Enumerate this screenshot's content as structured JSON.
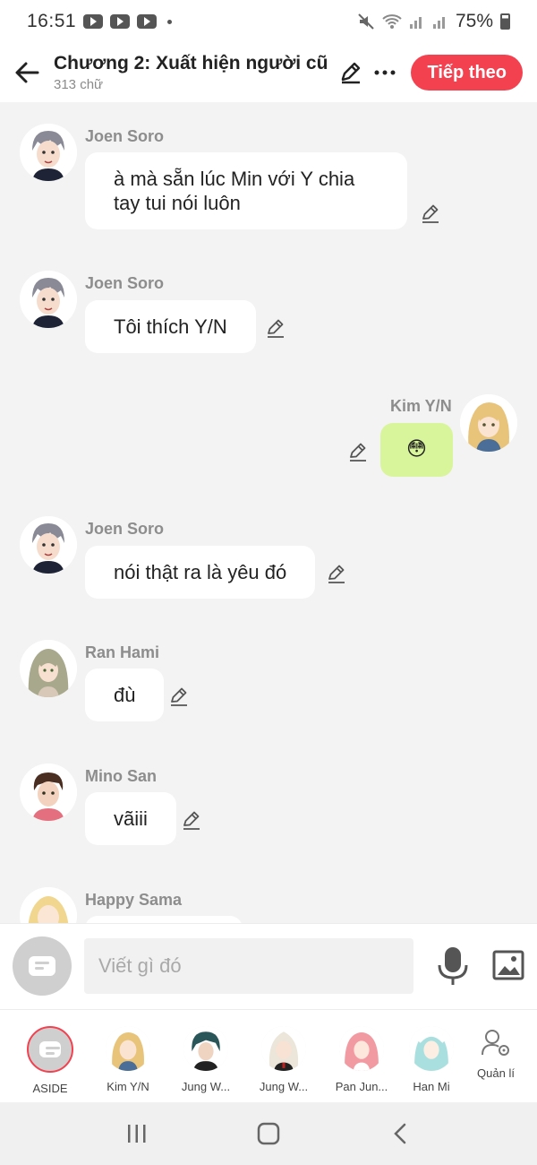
{
  "status": {
    "time": "16:51",
    "battery": "75%",
    "icons": [
      "youtube-icon",
      "youtube-icon",
      "youtube-icon",
      "mute-icon",
      "wifi-icon",
      "signal-icon",
      "signal-icon",
      "battery-icon"
    ]
  },
  "header": {
    "title": "Chương 2: Xuất hiện người cũ",
    "word_count": "313 chữ",
    "next_label": "Tiếp theo",
    "accent": "#f4414f"
  },
  "messages": [
    {
      "sender": "Joen Soro",
      "lines": [
        "à mà sẵn lúc Min với Y chia",
        "tay tui nói luôn"
      ],
      "side": "left"
    },
    {
      "sender": "Joen Soro",
      "lines": [
        "Tôi thích Y/N"
      ],
      "side": "left"
    },
    {
      "sender": "Kim Y/N",
      "lines": [
        "😳"
      ],
      "side": "right"
    },
    {
      "sender": "Joen Soro",
      "lines": [
        "nói thật ra là yêu đó"
      ],
      "side": "left"
    },
    {
      "sender": "Ran Hami",
      "lines": [
        "đù"
      ],
      "side": "left"
    },
    {
      "sender": "Mino San",
      "lines": [
        "vãiii"
      ],
      "side": "left"
    },
    {
      "sender": "Happy Sama",
      "lines": [
        ""
      ],
      "side": "left"
    }
  ],
  "input": {
    "placeholder": "Viết gì đó"
  },
  "characters": [
    {
      "label": "ASIDE"
    },
    {
      "label": "Kim Y/N"
    },
    {
      "label": "Jung W..."
    },
    {
      "label": "Jung W..."
    },
    {
      "label": "Pan Jun..."
    },
    {
      "label": "Han Mi"
    }
  ],
  "manage_label": "Quản lí",
  "colors": {
    "my_bubble": "#d9f59b",
    "bubble": "#ffffff",
    "background": "#f3f3f3"
  }
}
